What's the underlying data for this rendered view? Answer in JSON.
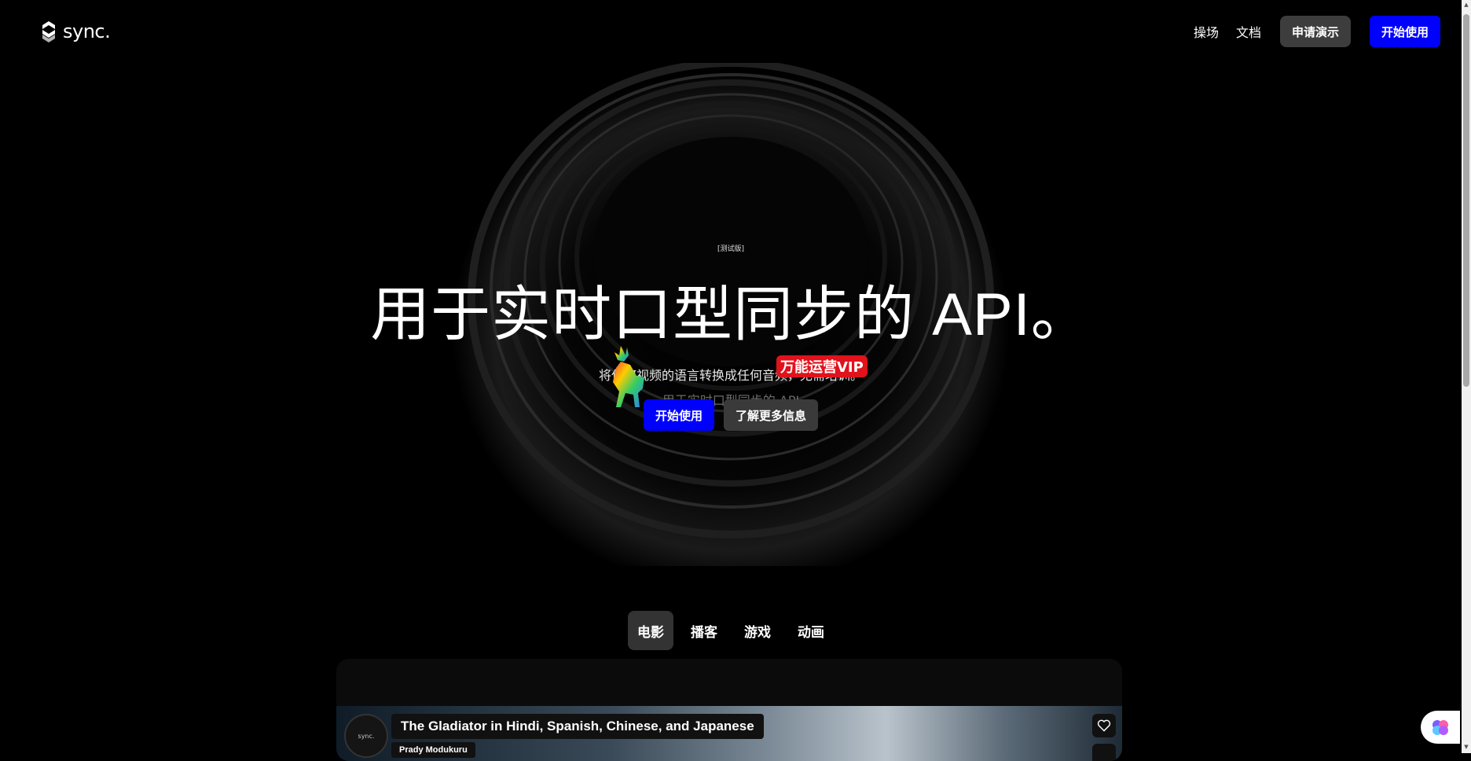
{
  "header": {
    "brand": "sync.",
    "nav": [
      "操场",
      "文档"
    ],
    "demo_button": "申请演示",
    "start_button": "开始使用"
  },
  "hero": {
    "badge": "[测试版]",
    "title": "用于实时口型同步的 API。",
    "subtitle": "将任何视频的语言转换成任何音频，无需培训。",
    "subtitle_overlap": "用于实时口型同步的 API",
    "primary_button": "开始使用",
    "secondary_button": "了解更多信息"
  },
  "watermark": {
    "badge_text": "万能运营VIP"
  },
  "tabs": {
    "items": [
      "电影",
      "播客",
      "游戏",
      "动画"
    ],
    "active": "电影"
  },
  "card": {
    "avatar_label": "sync.",
    "title": "The Gladiator in Hindi, Spanish, Chinese, and Japanese",
    "author": "Prady Modukuru"
  },
  "colors": {
    "accent": "#0000ff",
    "secondary_button": "#3a3a3a",
    "background": "#000000",
    "vip_badge": "#e0121c"
  }
}
